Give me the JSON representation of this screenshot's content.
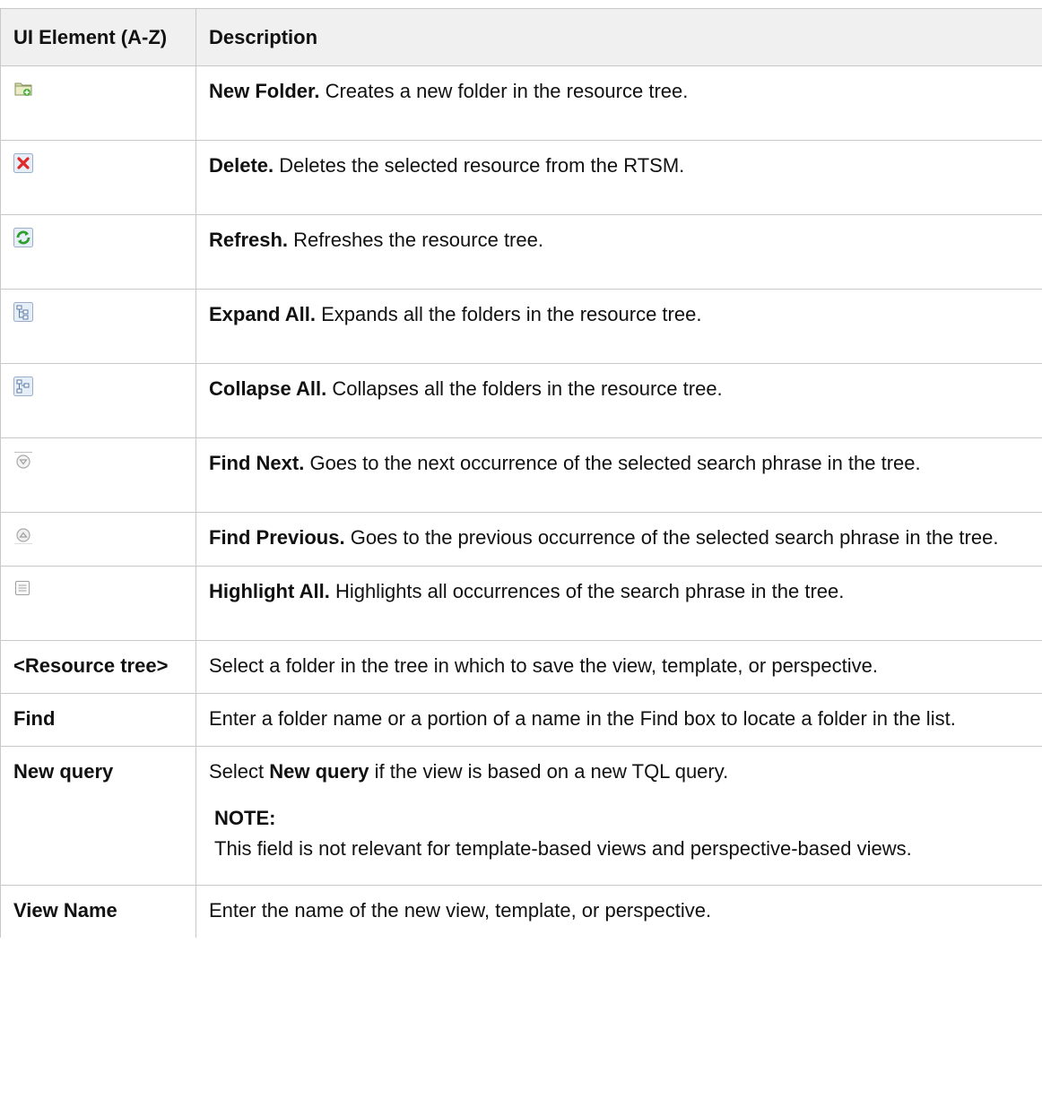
{
  "header": {
    "col1": "UI Element (A-Z)",
    "col2": "Description"
  },
  "rows": [
    {
      "icon": "new-folder-icon",
      "title": "New Folder.",
      "desc": " Creates a new folder in the resource tree."
    },
    {
      "icon": "delete-icon",
      "title": "Delete.",
      "desc": " Deletes the selected resource from the RTSM."
    },
    {
      "icon": "refresh-icon",
      "title": "Refresh.",
      "desc": " Refreshes the resource tree."
    },
    {
      "icon": "expand-all-icon",
      "title": "Expand All.",
      "desc": " Expands all the folders in the resource tree."
    },
    {
      "icon": "collapse-all-icon",
      "title": "Collapse All.",
      "desc": " Collapses all the folders in the resource tree."
    },
    {
      "icon": "find-next-icon",
      "title": "Find Next.",
      "desc": " Goes to the next occurrence of the selected search phrase in the tree."
    },
    {
      "icon": "find-previous-icon",
      "title": "Find Previous.",
      "desc": " Goes to the previous occurrence of the selected search phrase in the tree."
    },
    {
      "icon": "highlight-all-icon",
      "title": "Highlight All.",
      "desc": " Highlights all occurrences of the search phrase in the tree."
    }
  ],
  "text_rows": {
    "resource_tree": {
      "label": "<Resource tree>",
      "desc": "Select a folder in the tree in which to save the view, template, or perspective."
    },
    "find": {
      "label": "Find",
      "desc": "Enter a folder name or a portion of a name in the Find box to locate a folder in the list."
    },
    "new_query": {
      "label": "New query",
      "desc_pre": "Select ",
      "desc_bold": "New query",
      "desc_post": " if the view is based on a new TQL query.",
      "note_title": "NOTE:",
      "note_text": "This field is not relevant for template-based views and perspective-based views."
    },
    "view_name": {
      "label": "View Name",
      "desc": "Enter the name of the new view, template, or perspective."
    }
  }
}
